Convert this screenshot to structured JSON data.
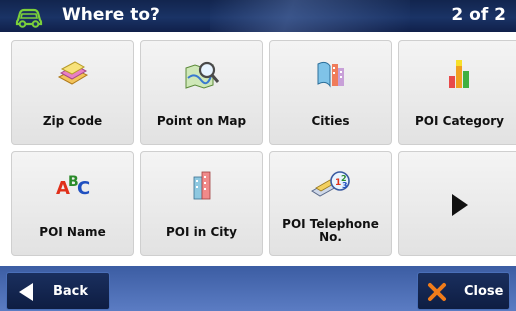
{
  "header": {
    "title": "Where to?",
    "page": "2 of 2",
    "icon": "car-icon"
  },
  "tiles": [
    {
      "label": "Zip Code",
      "icon": "zip-code-icon"
    },
    {
      "label": "Point on Map",
      "icon": "map-search-icon"
    },
    {
      "label": "Cities",
      "icon": "cities-icon"
    },
    {
      "label": "POI Category",
      "icon": "poi-category-icon"
    },
    {
      "label": "POI Name",
      "icon": "abc-letters-icon"
    },
    {
      "label": "POI in City",
      "icon": "city-building-icon"
    },
    {
      "label": "POI Telephone\nNo.",
      "icon": "telephone-dial-icon"
    },
    {
      "label": "",
      "icon": "next-arrow-icon"
    }
  ],
  "footer": {
    "back_label": "Back",
    "close_label": "Close"
  },
  "colors": {
    "header_bg": "#1a3366",
    "footer_bg": "#4a6cb3",
    "close_x": "#f07c1a"
  }
}
